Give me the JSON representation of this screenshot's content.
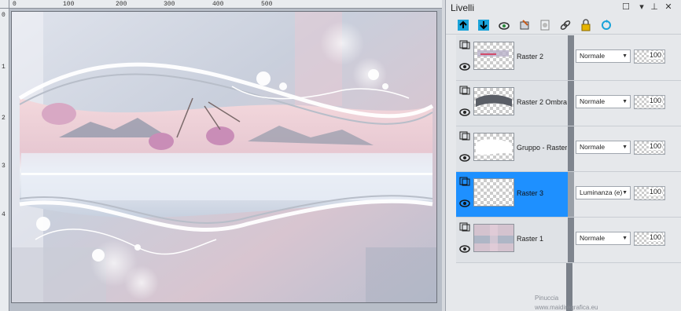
{
  "ruler": {
    "top_ticks": [
      "0",
      "100",
      "200",
      "300",
      "400",
      "500"
    ],
    "left_ticks": [
      "0",
      "1",
      "2",
      "3",
      "4"
    ]
  },
  "panel": {
    "title": "Livelli"
  },
  "toolbar": {
    "icons": [
      "new-layer-icon",
      "merge-down-icon",
      "visibility-icon",
      "paint-icon",
      "mask-icon",
      "link-icon",
      "lock-icon",
      "refresh-icon"
    ]
  },
  "layers": [
    {
      "name": "Raster 2",
      "blend": "Normale",
      "opacity": "100",
      "selected": false
    },
    {
      "name": "Raster 2 Ombra",
      "blend": "Normale",
      "opacity": "100",
      "selected": false
    },
    {
      "name": "Gruppo - Raster",
      "blend": "Normale",
      "opacity": "100",
      "selected": false
    },
    {
      "name": "Raster 3",
      "blend": "Luminanza (e)",
      "opacity": "100",
      "selected": true
    },
    {
      "name": "Raster 1",
      "blend": "Normale",
      "opacity": "100",
      "selected": false
    }
  ],
  "watermark": {
    "line1": "Pinuccia",
    "line2": "www.maidiregrafica.eu"
  },
  "colors": {
    "selected": "#1e90ff",
    "toolbar_accent": "#1aa3d9"
  }
}
